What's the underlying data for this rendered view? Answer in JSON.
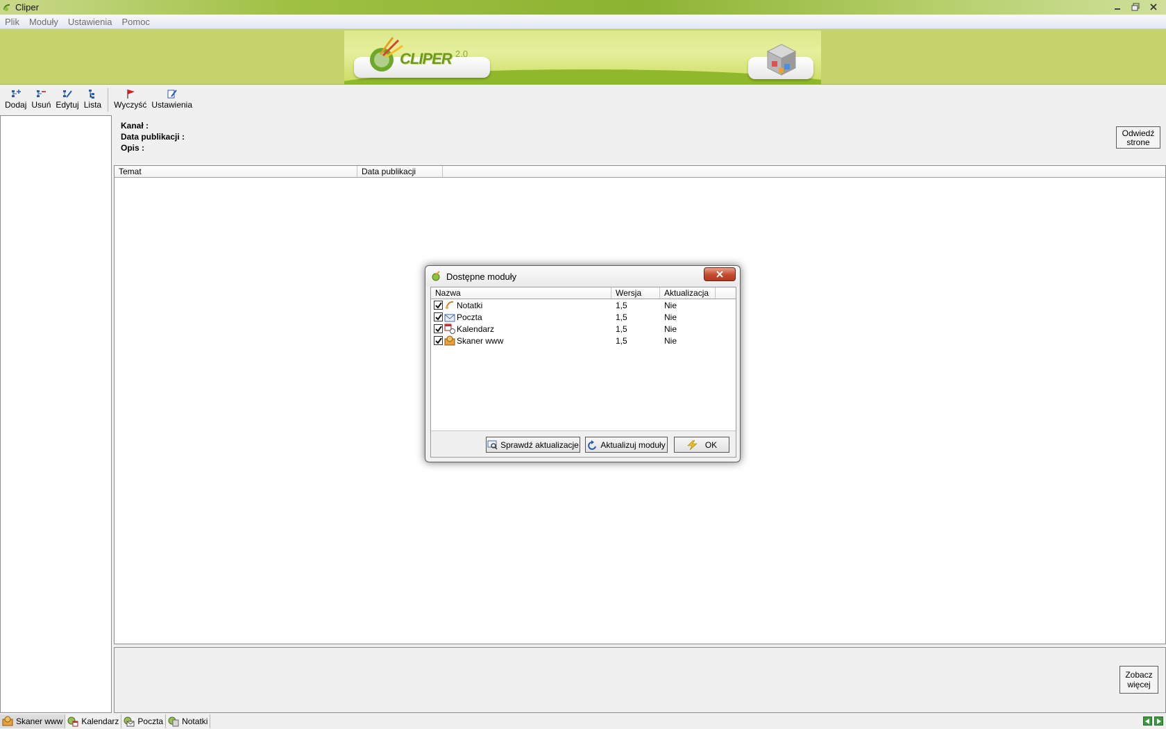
{
  "window": {
    "title": "Cliper"
  },
  "menu": {
    "items": [
      "Plik",
      "Moduły",
      "Ustawienia",
      "Pomoc"
    ]
  },
  "banner": {
    "logo_text": "CLIPER",
    "logo_version": "2.0"
  },
  "toolbar": {
    "add": "Dodaj",
    "remove": "Usuń",
    "edit": "Edytuj",
    "list": "Lista",
    "clear": "Wyczyść",
    "settings": "Ustawienia"
  },
  "info": {
    "channel": "Kanał :",
    "pub_date": "Data publikacji :",
    "desc": "Opis :"
  },
  "buttons": {
    "visit_line1": "Odwiedź",
    "visit_line2": "strone",
    "more_line1": "Zobacz",
    "more_line2": "więcej"
  },
  "list": {
    "columns": [
      "Temat",
      "Data publikacji"
    ]
  },
  "tabs": [
    "Skaner www",
    "Kalendarz",
    "Poczta",
    "Notatki"
  ],
  "dialog": {
    "title": "Dostępne moduły",
    "columns": [
      "Nazwa",
      "Wersja",
      "Aktualizacja"
    ],
    "rows": [
      {
        "name": "Notatki",
        "version": "1,5",
        "update": "Nie"
      },
      {
        "name": "Poczta",
        "version": "1,5",
        "update": "Nie"
      },
      {
        "name": "Kalendarz",
        "version": "1,5",
        "update": "Nie"
      },
      {
        "name": "Skaner www",
        "version": "1,5",
        "update": "Nie"
      }
    ],
    "check_updates": "Sprawdź aktualizacje",
    "update_modules": "Aktualizuj moduły",
    "ok": "OK"
  }
}
